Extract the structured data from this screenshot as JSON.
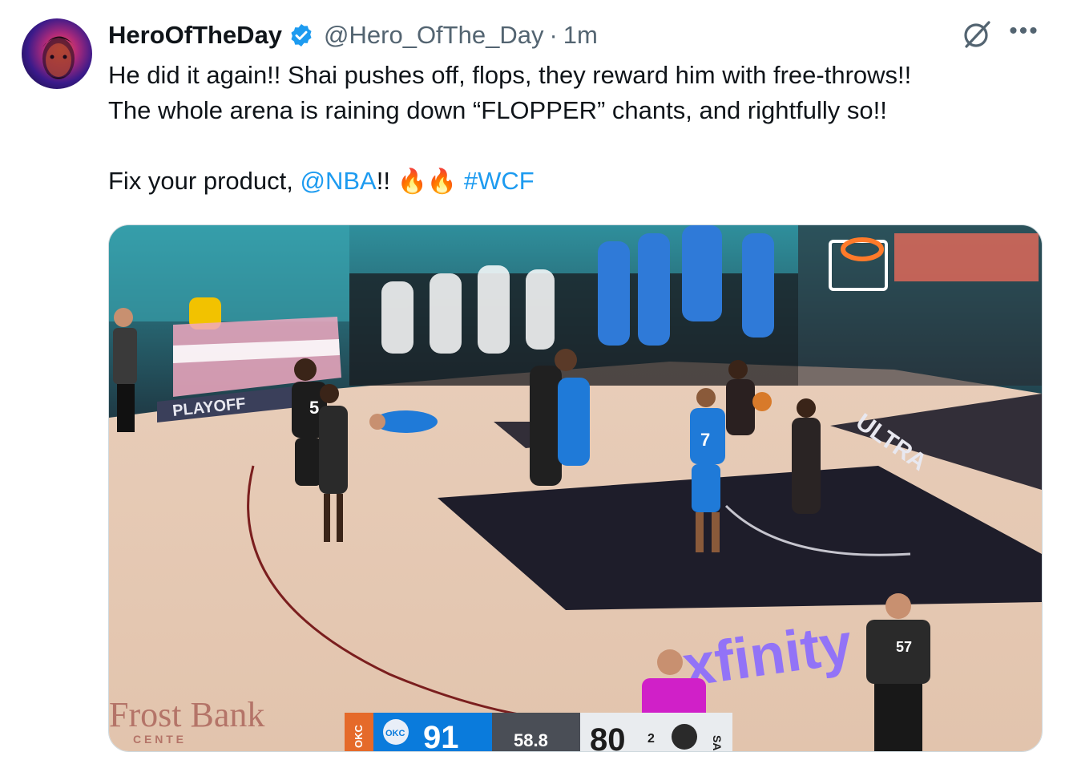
{
  "author": {
    "display_name": "HeroOfTheDay",
    "handle": "@Hero_OfThe_Day",
    "separator": "·",
    "timestamp": "1m",
    "avatar_icon": "avatar-portrait",
    "verified_icon": "verified-badge-icon"
  },
  "tweet": {
    "line1": "He did it again!! Shai pushes off, flops, they reward him with free-throws!!",
    "line2": "The whole arena is raining down “FLOPPER” chants, and rightfully so!!",
    "line3_prefix": "Fix your product, ",
    "mention": "@NBA",
    "line3_after_mention": "!! ",
    "emoji": "🔥🔥",
    "hashtag": "#WCF"
  },
  "icons": {
    "grok": "grok-icon",
    "more": "more-options-icon",
    "more_glyph": "•••"
  },
  "media": {
    "arena_sign": "PLAYOFF",
    "sponsor_court": "ULTRA",
    "sponsor_floor": "xfinity",
    "venue": "Frost Bank",
    "venue_sub": "C E N T E",
    "players": {
      "oklahoma_number": "7",
      "spurs_number": "5"
    },
    "referee_badge": "57",
    "scoreboard": {
      "home_team": "OKC",
      "home_score": "91",
      "clock": "58.8",
      "away_score": "80",
      "away_team": "SA",
      "quarter_indicator": "2"
    },
    "colors": {
      "okc_blue": "#0a7bdc",
      "spurs_black": "#1c1c1c",
      "floor": "#e8cdb7",
      "paint": "#1e1d2a",
      "xfinity": "#8a6bff",
      "stands_teal": "#2fa3b0"
    }
  },
  "colors": {
    "link": "#1d9bf0",
    "text": "#0f1419",
    "muted": "#536471",
    "verified": "#1d9bf0"
  }
}
